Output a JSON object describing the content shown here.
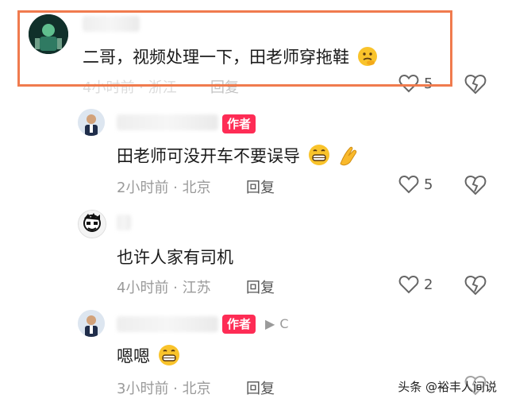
{
  "comments": [
    {
      "id": "c1",
      "text": "二哥，视频处理一下，田老师穿拖鞋",
      "time_location": "4小时前 · 浙江",
      "reply_label": "回复",
      "likes": "5",
      "highlighted": true
    },
    {
      "id": "c2",
      "badge": "作者",
      "text": "田老师可没开车不要误导",
      "time_location": "2小时前 · 北京",
      "reply_label": "回复",
      "likes": "5"
    },
    {
      "id": "c3",
      "text": "也许人家有司机",
      "time_location": "4小时前 · 江苏",
      "reply_label": "回复",
      "likes": "2"
    },
    {
      "id": "c4",
      "badge": "作者",
      "badge_suffix": "C",
      "text": "嗯嗯",
      "time_location": "3小时前 · 北京",
      "reply_label": "回复",
      "likes": ""
    }
  ],
  "watermark": "头条 @裕丰人间说",
  "colors": {
    "accent": "#fe2c55",
    "highlight": "#f07b4e",
    "meta": "#9a9a9a"
  }
}
